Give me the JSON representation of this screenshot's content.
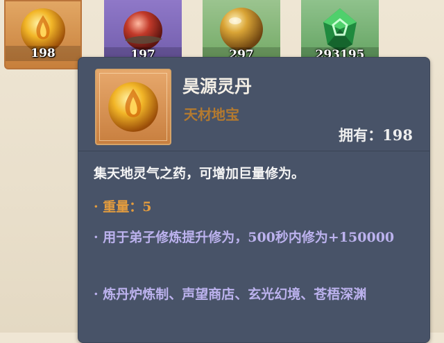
{
  "slots": [
    {
      "count": "198",
      "item": "golden flame elixir",
      "color": "#d8924f"
    },
    {
      "count": "197",
      "item": "crimson pill",
      "color": "#7f69b8"
    },
    {
      "count": "297",
      "item": "amber orb",
      "color": "#84b678"
    },
    {
      "count": "293195",
      "item": "jade crystal",
      "color": "#78b274"
    }
  ],
  "tooltip": {
    "name": "昊源灵丹",
    "category": "天材地宝",
    "owned": "拥有：198",
    "description": "集天地灵气之药，可增加巨量修为。",
    "weight": "· 重量：5",
    "usage": "· 用于弟子修炼提升修为，500秒内修为+150000",
    "source": "· 炼丹炉炼制、声望商店、玄光幻境、苍梧深渊",
    "name_color": "#f4efe6",
    "category_color": "#b47a2f",
    "weight_color": "#e39c3e",
    "detail_color": "#bcb2ee"
  }
}
